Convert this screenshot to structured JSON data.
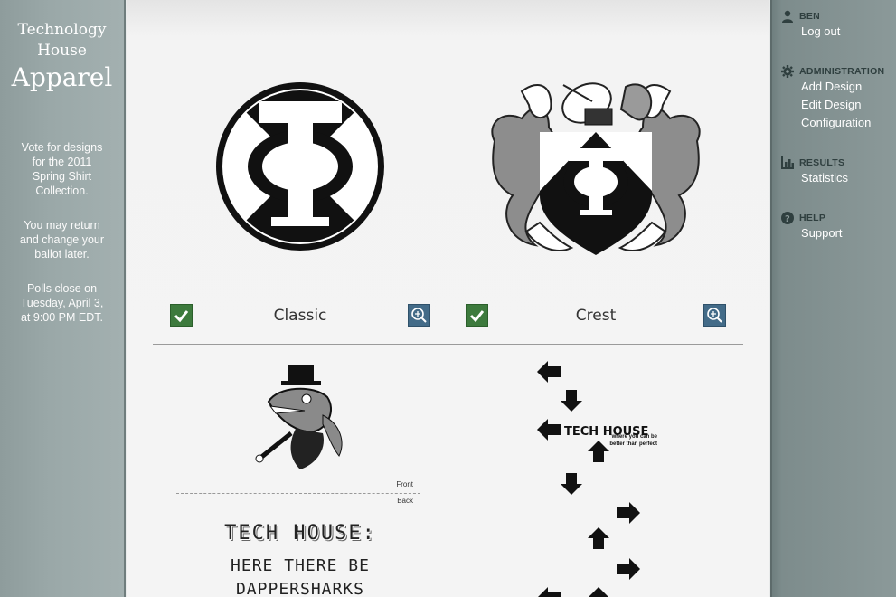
{
  "brand": {
    "line1": "Technology",
    "line2": "House",
    "line3": "Apparel"
  },
  "sidebar_left": {
    "intro": "Vote for designs for the 2011 Spring Shirt Collection.",
    "return_note": "You may return and change your ballot later.",
    "deadline": "Polls close on Tuesday, April 3, at 9:00 PM EDT."
  },
  "designs": [
    {
      "name": "Classic",
      "selected": true
    },
    {
      "name": "Crest",
      "selected": true
    },
    {
      "name": "",
      "front_label": "Front",
      "back_label": "Back",
      "back_line1": "TECH HOUSE:",
      "back_line2": "HERE THERE BE",
      "back_line3": "DAPPERSHARKS"
    },
    {
      "name": "",
      "tagline_title": "TECH HOUSE",
      "tagline": "where you can be better than perfect"
    }
  ],
  "sidebar_right": {
    "user": {
      "heading": "BEN",
      "links": [
        "Log out"
      ]
    },
    "admin": {
      "heading": "ADMINISTRATION",
      "links": [
        "Add Design",
        "Edit Design",
        "Configuration"
      ]
    },
    "results": {
      "heading": "RESULTS",
      "links": [
        "Statistics"
      ]
    },
    "help": {
      "heading": "HELP",
      "links": [
        "Support"
      ]
    }
  },
  "colors": {
    "check": "#3d7a3d",
    "zoom": "#436b88",
    "sidebar": "#97a5a5",
    "panel": "#f4f4f4"
  }
}
